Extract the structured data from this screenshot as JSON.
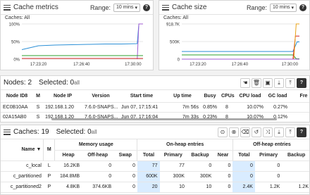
{
  "cache_metrics": {
    "title": "Cache metrics",
    "range_label": "Range:",
    "range_value": "10 mins",
    "caches": "Caches: All",
    "chart_data": {
      "type": "line",
      "yticks": [
        "100%",
        "50%",
        "0%"
      ],
      "xticks": [
        "17:23:20",
        "17:26:40",
        "17:30:00"
      ],
      "ylim": [
        0,
        100
      ],
      "series": [
        {
          "color": "#2b8fd6",
          "values": [
            [
              0,
              27
            ],
            [
              1,
              38
            ],
            [
              2,
              40
            ],
            [
              3,
              41
            ],
            [
              4,
              42
            ],
            [
              5,
              43
            ],
            [
              6,
              43
            ],
            [
              6.95,
              44
            ],
            [
              7.05,
              100
            ],
            [
              7.3,
              100
            ]
          ]
        },
        {
          "color": "#a05ed3",
          "values": [
            [
              6.95,
              0
            ],
            [
              7.05,
              100
            ],
            [
              7.3,
              100
            ]
          ]
        },
        {
          "color": "#2ca02c",
          "values": [
            [
              0,
              10
            ],
            [
              7.3,
              10
            ]
          ]
        },
        {
          "color": "#d62728",
          "values": [
            [
              0,
              2
            ],
            [
              7.3,
              2
            ]
          ]
        }
      ]
    }
  },
  "cache_size": {
    "title": "Cache size",
    "range_label": "Range:",
    "range_value": "10 mins",
    "caches": "Caches: All",
    "chart_data": {
      "type": "line",
      "yticks": [
        "918.7K",
        "500K",
        "0"
      ],
      "xticks": [
        "17:23:20",
        "17:26:40",
        "17:30:00"
      ],
      "ylim": [
        0,
        918.7
      ],
      "series": [
        {
          "color": "#2b8fd6",
          "values": [
            [
              0,
              200
            ],
            [
              6.9,
              200
            ],
            [
              7.15,
              450
            ],
            [
              7.3,
              450
            ]
          ]
        },
        {
          "color": "#2ca02c",
          "values": [
            [
              0,
              110
            ],
            [
              6.9,
              110
            ],
            [
              7.1,
              10
            ],
            [
              7.3,
              10
            ]
          ]
        },
        {
          "color": "#d62728",
          "values": [
            [
              0,
              0
            ],
            [
              6.9,
              0
            ],
            [
              7.05,
              600
            ],
            [
              7.3,
              600
            ]
          ]
        },
        {
          "color": "#e8a317",
          "values": [
            [
              0,
              0
            ],
            [
              6.95,
              0
            ],
            [
              7.1,
              918
            ],
            [
              7.3,
              918
            ]
          ]
        },
        {
          "color": "#a05ed3",
          "values": [
            [
              0,
              0
            ],
            [
              7.3,
              0
            ]
          ]
        }
      ]
    }
  },
  "nodes": {
    "title": "Nodes: 2",
    "selected_label": "Selected:",
    "selected_count": "0",
    "selected_suffix": "all",
    "headers": [
      "Node ID8",
      "M",
      "Node IP",
      "Version",
      "Start time",
      "Up time",
      "Busy",
      "CPUs",
      "CPU load",
      "GC load",
      "Fre"
    ],
    "rows": [
      [
        "EC0B10AA",
        "S",
        "192.168.1.20",
        "7.6.0-SNAPS...",
        "Jun 07, 17:15:41",
        "7m 56s",
        "0.85%",
        "8",
        "10.07%",
        "0.27%",
        ""
      ],
      [
        "02A15AB0",
        "S",
        "192.168.1.20",
        "7.6.0-SNAPS...",
        "Jun 07, 17:16:04",
        "7m 33s",
        "0.23%",
        "8",
        "10.07%",
        "0.12%",
        ""
      ]
    ]
  },
  "caches": {
    "title": "Caches: 19",
    "selected_label": "Selected:",
    "selected_count": "0",
    "selected_suffix": "all",
    "group_headers": {
      "memory": "Memory usage",
      "onheap": "On-heap entries",
      "offheap": "Off-heap entries"
    },
    "headers": {
      "name": "Name",
      "sort_arrow": "▼",
      "m": "M",
      "heap": "Heap",
      "offheap": "Off-heap",
      "swap": "Swap",
      "total": "Total",
      "primary": "Primary",
      "backup": "Backup",
      "near": "Near",
      "total2": "Total",
      "primary2": "Primary",
      "backup2": "Backup"
    },
    "rows": [
      {
        "name": "c_local",
        "m": "L",
        "heap": "16.2KB",
        "offheap": "0",
        "swap": "0",
        "total": "77",
        "primary": "77",
        "backup": "0",
        "near": "0",
        "total2": "0",
        "primary2": "0",
        "backup2": ""
      },
      {
        "name": "c_partitioned",
        "m": "P",
        "heap": "184.8MB",
        "offheap": "0",
        "swap": "0",
        "total": "600K",
        "primary": "300K",
        "backup": "300K",
        "near": "0",
        "total2": "0",
        "primary2": "0",
        "backup2": ""
      },
      {
        "name": "c_partitioned2",
        "m": "P",
        "heap": "4.8KB",
        "offheap": "374.6KB",
        "swap": "0",
        "total": "20",
        "primary": "10",
        "backup": "10",
        "near": "0",
        "total2": "2.4K",
        "primary2": "1.2K",
        "backup2": "1.2K"
      }
    ]
  }
}
